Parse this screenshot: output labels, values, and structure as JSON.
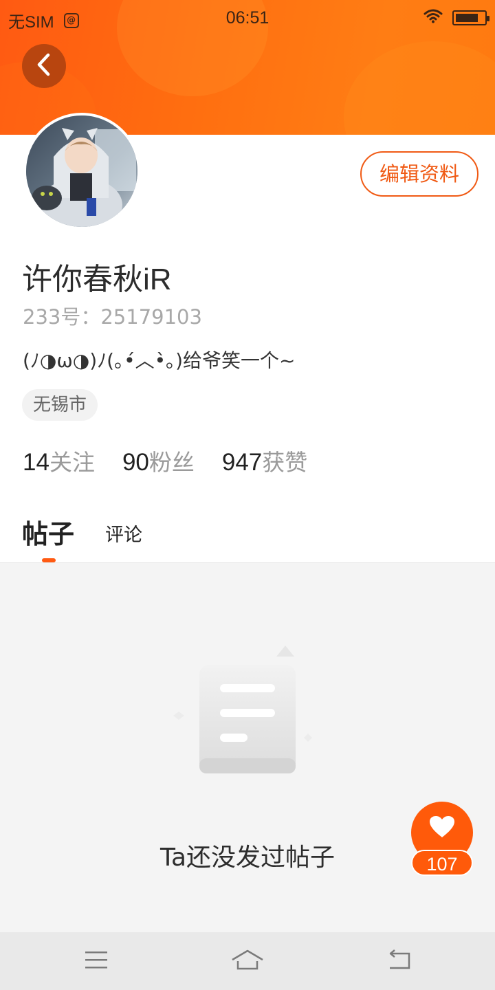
{
  "status_bar": {
    "carrier": "无SIM",
    "time": "06:51",
    "battery_level": 0.8,
    "icons": [
      "app-notification-icon",
      "wifi-icon",
      "battery-icon"
    ]
  },
  "header": {
    "back_icon": "chevron-left-icon"
  },
  "profile": {
    "edit_label": "编辑资料",
    "name": "许你春秋iR",
    "uid_text": "233号：25179103",
    "bio": "(ﾉ◑ω◑)ﾉ(｡•́︿•̀｡)给爷笑一个~",
    "location": "无锡市",
    "stats": [
      {
        "num": "14",
        "label": "关注"
      },
      {
        "num": "90",
        "label": "粉丝"
      },
      {
        "num": "947",
        "label": "获赞"
      }
    ]
  },
  "tabs": {
    "posts": "帖子",
    "comments": "评论"
  },
  "empty_state": {
    "icon": "document-icon",
    "text": "Ta还没发过帖子"
  },
  "like_fab": {
    "icon": "heart-icon",
    "count": "107"
  },
  "nav_bar": {
    "icons": [
      "menu-icon",
      "home-icon",
      "back-icon"
    ]
  },
  "colors": {
    "accent": "#ff5a12",
    "header_gradient_start": "#ff5a12",
    "header_gradient_end": "#ff7d14",
    "back_button": "#b8450f",
    "content_bg": "#f4f4f4",
    "nav_bg": "#e9e9e9"
  }
}
